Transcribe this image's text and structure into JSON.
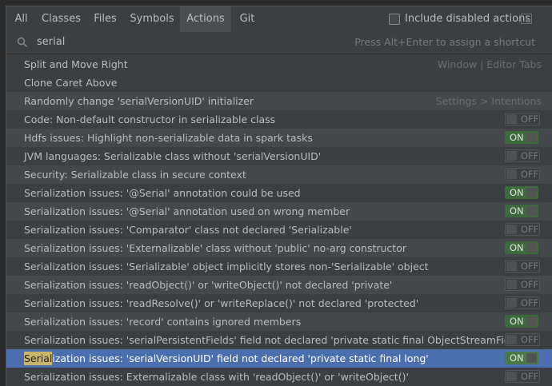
{
  "tabs": [
    {
      "label": "All"
    },
    {
      "label": "Classes"
    },
    {
      "label": "Files"
    },
    {
      "label": "Symbols"
    },
    {
      "label": "Actions"
    },
    {
      "label": "Git"
    }
  ],
  "active_tab": "Actions",
  "include_disabled": {
    "label": "Include disabled actions",
    "checked": false
  },
  "search": {
    "value": "serial",
    "hint": "Press Alt+Enter to assign a shortcut"
  },
  "toggle_labels": {
    "on": "ON",
    "off": "OFF"
  },
  "rows": [
    {
      "label": "Split and Move Right",
      "right": "Window | Editor Tabs",
      "toggle": null
    },
    {
      "label": "Clone Caret Above",
      "right": "",
      "toggle": null
    },
    {
      "label": "Randomly change 'serialVersionUID' initializer",
      "right": "Settings > Intentions",
      "toggle": null
    },
    {
      "label": "Code: Non-default constructor in serializable class",
      "right": "",
      "toggle": "off"
    },
    {
      "label": "Hdfs issues: Highlight non-serializable data in spark tasks",
      "right": "",
      "toggle": "on"
    },
    {
      "label": "JVM languages: Serializable class without 'serialVersionUID'",
      "right": "",
      "toggle": "off"
    },
    {
      "label": "Security: Serializable class in secure context",
      "right": "",
      "toggle": "off"
    },
    {
      "label": "Serialization issues: '@Serial' annotation could be used",
      "right": "",
      "toggle": "on"
    },
    {
      "label": "Serialization issues: '@Serial' annotation used on wrong member",
      "right": "",
      "toggle": "on"
    },
    {
      "label": "Serialization issues: 'Comparator' class not declared 'Serializable'",
      "right": "",
      "toggle": "off"
    },
    {
      "label": "Serialization issues: 'Externalizable' class without 'public' no-arg constructor",
      "right": "",
      "toggle": "on"
    },
    {
      "label": "Serialization issues: 'Serializable' object implicitly stores non-'Serializable' object",
      "right": "",
      "toggle": "off"
    },
    {
      "label": "Serialization issues: 'readObject()' or 'writeObject()' not declared 'private'",
      "right": "",
      "toggle": "off"
    },
    {
      "label": "Serialization issues: 'readResolve()' or 'writeReplace()' not declared 'protected'",
      "right": "",
      "toggle": "off"
    },
    {
      "label": "Serialization issues: 'record' contains ignored members",
      "right": "",
      "toggle": "on"
    },
    {
      "label": "Serialization issues: 'serialPersistentFields' field not declared 'private static final ObjectStreamField[]'",
      "right": "",
      "toggle": "off"
    },
    {
      "label_highlight": "Serial",
      "label": "ization issues: 'serialVersionUID' field not declared 'private static final long'",
      "right": "",
      "toggle": "on",
      "selected": true
    },
    {
      "label": "Serialization issues: Externalizable class with 'readObject()' or 'writeObject()'",
      "right": "",
      "toggle": "off"
    }
  ],
  "colors": {
    "selection": "#4b6eaf",
    "toggle_on": "#3d6a3a",
    "highlight": "#c9b46a"
  }
}
